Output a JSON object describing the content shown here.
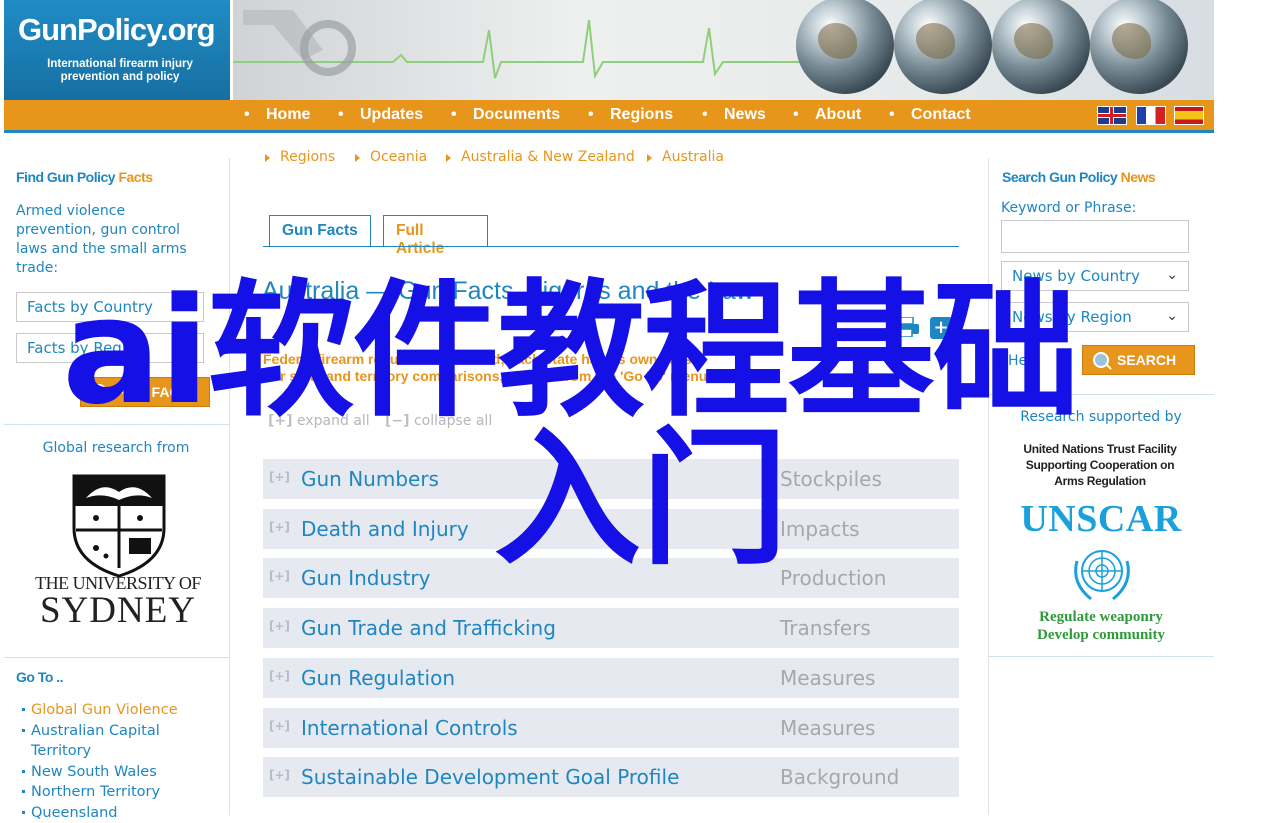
{
  "header": {
    "logo_title": "GunPolicy.org",
    "logo_subtitle_1": "International firearm injury",
    "logo_subtitle_2": "prevention and policy"
  },
  "nav": {
    "items": [
      "Home",
      "Updates",
      "Documents",
      "Regions",
      "News",
      "About",
      "Contact"
    ],
    "languages": [
      "english-flag",
      "french-flag",
      "spanish-flag"
    ],
    "color": "#e8951c"
  },
  "left_sidebar": {
    "facts_heading_a": "Find Gun Policy",
    "facts_heading_b": "Facts",
    "facts_desc_1": "Armed violence",
    "facts_desc_2": "prevention, gun control",
    "facts_desc_3": "laws and the small arms",
    "facts_desc_4": "trade:",
    "select_country": "Facts by Country",
    "select_region": "Facts by Region",
    "find_facts_button": "FIND FACTS",
    "research_heading": "Global research from",
    "usyd_line1": "THE UNIVERSITY OF",
    "usyd_line2": "SYDNEY",
    "goto_heading": "Go To ..",
    "goto_items": [
      "Global Gun Violence",
      "Australian Capital Territory",
      "New South Wales",
      "Northern Territory",
      "Queensland"
    ]
  },
  "main": {
    "breadcrumbs": [
      "Regions",
      "Oceania",
      "Australia & New Zealand",
      "Australia"
    ],
    "tab_gun_facts": "Gun Facts",
    "tab_full_article": "Full Article",
    "title": "Australia — Gun Facts, Figures and the Law",
    "intro_line1": "Federal firearm regulation is limited; each state has its own laws.",
    "intro_line2": "For state and territory comparisons, choose from the 'Go To' menu.",
    "expand_all": "expand all",
    "collapse_all": "collapse all",
    "topics": [
      {
        "label": "Gun Numbers",
        "category": "Stockpiles"
      },
      {
        "label": "Death and Injury",
        "category": "Impacts"
      },
      {
        "label": "Gun Industry",
        "category": "Production"
      },
      {
        "label": "Gun Trade and Trafficking",
        "category": "Transfers"
      },
      {
        "label": "Gun Regulation",
        "category": "Measures"
      },
      {
        "label": "International Controls",
        "category": "Measures"
      },
      {
        "label": "Sustainable Development Goal Profile",
        "category": "Background"
      }
    ]
  },
  "right_sidebar": {
    "news_heading_a": "Search Gun Policy",
    "news_heading_b": "News",
    "keyword_label": "Keyword or Phrase:",
    "keyword_value": "",
    "select_country": "News by Country",
    "select_region": "News by Region",
    "help_label": "Help",
    "search_button": "SEARCH",
    "research_label": "Research supported by",
    "unscar_line1": "United Nations Trust Facility",
    "unscar_line2": "Supporting Cooperation on",
    "unscar_line3": "Arms Regulation",
    "unscar_logo": "UNSCAR",
    "unscar_tag1": "Regulate weaponry",
    "unscar_tag2": "Develop community"
  },
  "watermark": {
    "line1": "ai软件教程基础",
    "line2": "入门"
  }
}
